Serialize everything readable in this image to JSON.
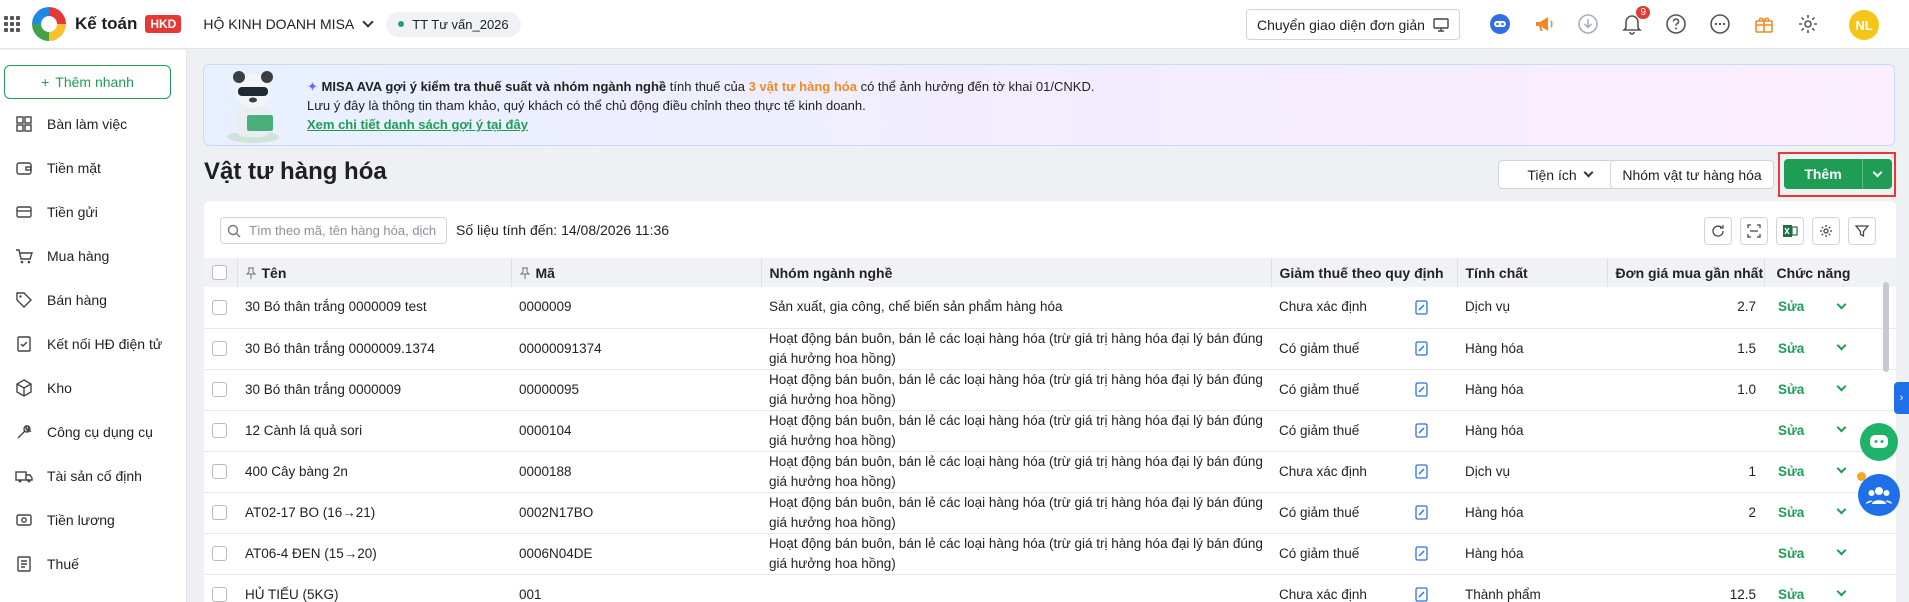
{
  "topbar": {
    "app_name": "Kế toán",
    "badge": "HKD",
    "company": "HỘ KINH DOANH MISA",
    "org": "TT Tư vấn_2026",
    "switch_ui_label": "Chuyển giao diện đơn giản",
    "notification_count": "9",
    "user_initials": "NL"
  },
  "sidebar": {
    "quick_add": "Thêm nhanh",
    "items": [
      {
        "label": "Bàn làm việc",
        "icon": "dashboard-icon"
      },
      {
        "label": "Tiền mặt",
        "icon": "wallet-icon"
      },
      {
        "label": "Tiền gửi",
        "icon": "bank-card-icon"
      },
      {
        "label": "Mua hàng",
        "icon": "cart-icon"
      },
      {
        "label": "Bán hàng",
        "icon": "tag-icon"
      },
      {
        "label": "Kết nối HĐ điện tử",
        "icon": "invoice-icon"
      },
      {
        "label": "Kho",
        "icon": "box-icon"
      },
      {
        "label": "Công cụ dụng cụ",
        "icon": "tools-icon"
      },
      {
        "label": "Tài sản cố định",
        "icon": "truck-icon"
      },
      {
        "label": "Tiền lương",
        "icon": "payroll-icon"
      },
      {
        "label": "Thuế",
        "icon": "tax-doc-icon"
      }
    ]
  },
  "banner": {
    "title": "MISA AVA gợi ý kiểm tra thuế suất và nhóm ngành nghề",
    "text1": " tính thuế của ",
    "highlight": "3 vật tư hàng hóa",
    "text2": " có thể ảnh hưởng đến tờ khai 01/CNKD.",
    "line2": "Lưu ý đây là thông tin tham khảo, quý khách có thể chủ động điều chỉnh theo thực tế kinh doanh.",
    "link": "Xem chi tiết danh sách gợi ý tại đây"
  },
  "page": {
    "title": "Vật tư hàng hóa",
    "utilities_label": "Tiện ích",
    "group_label": "Nhóm vật tư hàng hóa",
    "add_label": "Thêm"
  },
  "toolbar": {
    "search_placeholder": "Tìm theo mã, tên hàng hóa, dịch vụ",
    "data_time": "Số liệu tính đến: 14/08/2026 11:36"
  },
  "table": {
    "headers": {
      "name": "Tên",
      "code": "Mã",
      "industry": "Nhóm ngành nghề",
      "tax_reduction": "Giảm thuế theo quy định",
      "nature": "Tính chất",
      "price": "Đơn giá mua gần nhất",
      "actions": "Chức năng"
    },
    "edit_label": "Sửa",
    "rows": [
      {
        "name": "30 Bó thân trắng 0000009 test",
        "code": "0000009",
        "industry": "Sản xuất, gia công, chế biến sản phẩm hàng hóa",
        "tax": "Chưa xác định",
        "nature": "Dịch vụ",
        "price": "2.7"
      },
      {
        "name": "30 Bó thân trắng 0000009.1374",
        "code": "00000091374",
        "industry": "Hoạt động bán buôn, bán lẻ các loại hàng hóa (trừ giá trị hàng hóa đại lý bán đúng giá hưởng hoa hồng)",
        "tax": "Có giảm thuế",
        "nature": "Hàng hóa",
        "price": "1.5"
      },
      {
        "name": "30 Bó thân trắng 0000009",
        "code": "00000095",
        "industry": "Hoạt động bán buôn, bán lẻ các loại hàng hóa (trừ giá trị hàng hóa đại lý bán đúng giá hưởng hoa hồng)",
        "tax": "Có giảm thuế",
        "nature": "Hàng hóa",
        "price": "1.0"
      },
      {
        "name": "12 Cành lá quả sori",
        "code": "0000104",
        "industry": "Hoạt động bán buôn, bán lẻ các loại hàng hóa (trừ giá trị hàng hóa đại lý bán đúng giá hưởng hoa hồng)",
        "tax": "Có giảm thuế",
        "nature": "Hàng hóa",
        "price": ""
      },
      {
        "name": "400 Cây bàng 2n",
        "code": "0000188",
        "industry": "Hoạt động bán buôn, bán lẻ các loại hàng hóa (trừ giá trị hàng hóa đại lý bán đúng giá hưởng hoa hồng)",
        "tax": "Chưa xác định",
        "nature": "Dịch vụ",
        "price": "1"
      },
      {
        "name": "AT02-17 BO (16→21)",
        "code": "0002N17BO",
        "industry": "Hoạt động bán buôn, bán lẻ các loại hàng hóa (trừ giá trị hàng hóa đại lý bán đúng giá hưởng hoa hồng)",
        "tax": "Có giảm thuế",
        "nature": "Hàng hóa",
        "price": "2"
      },
      {
        "name": "AT06-4 ĐEN (15→20)",
        "code": "0006N04DE",
        "industry": "Hoạt động bán buôn, bán lẻ các loại hàng hóa (trừ giá trị hàng hóa đại lý bán đúng giá hưởng hoa hồng)",
        "tax": "Có giảm thuế",
        "nature": "Hàng hóa",
        "price": ""
      },
      {
        "name": "HỦ TIẾU (5KG)",
        "code": "001",
        "industry": "",
        "tax": "Chưa xác định",
        "nature": "Thành phẩm",
        "price": "12.5"
      }
    ]
  },
  "colors": {
    "primary_green": "#1f9d55",
    "highlight_orange": "#f08a24",
    "hkd_red": "#e53935",
    "accent_blue": "#1e6fe8"
  }
}
